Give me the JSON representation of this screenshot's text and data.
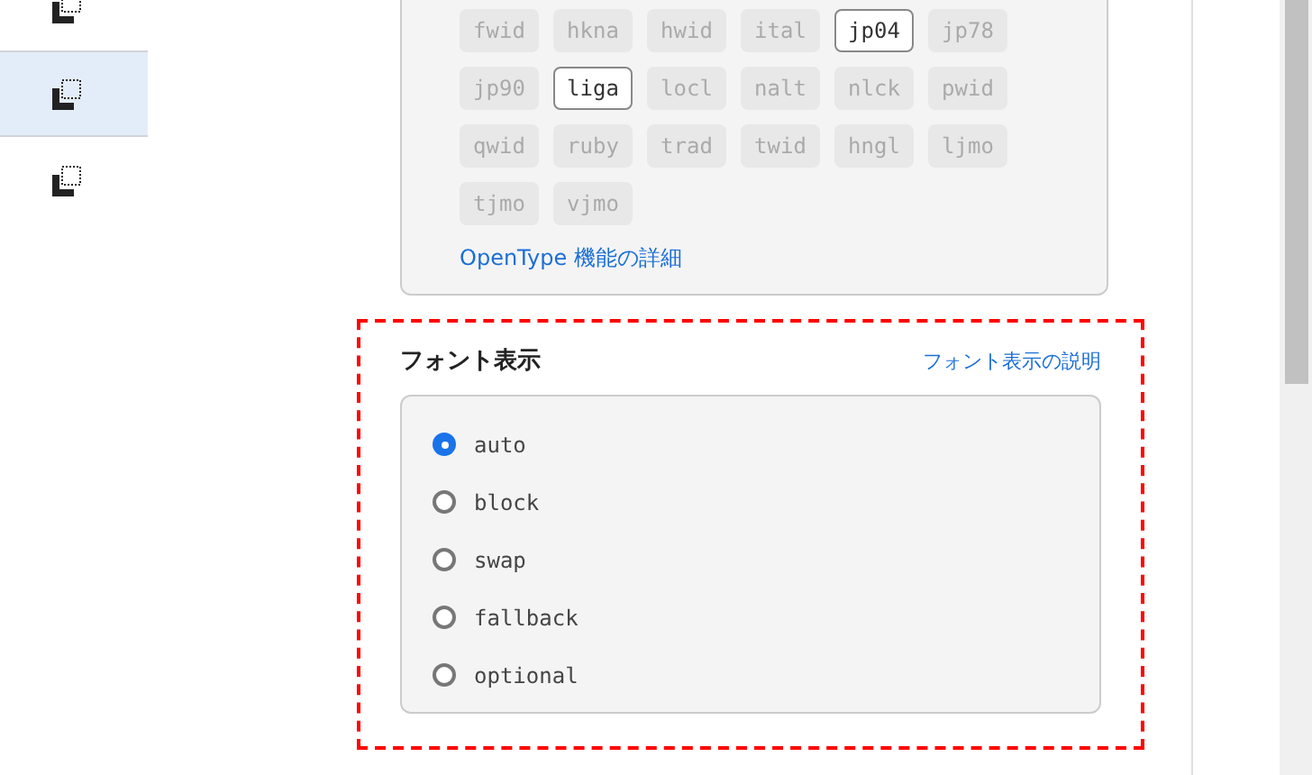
{
  "sidebar": {
    "items": [
      {
        "selected": false
      },
      {
        "selected": true
      },
      {
        "selected": false
      }
    ]
  },
  "opentype": {
    "features": [
      {
        "label": "fwid",
        "enabled": false
      },
      {
        "label": "hkna",
        "enabled": false
      },
      {
        "label": "hwid",
        "enabled": false
      },
      {
        "label": "ital",
        "enabled": false
      },
      {
        "label": "jp04",
        "enabled": true
      },
      {
        "label": "jp78",
        "enabled": false
      },
      {
        "label": "jp90",
        "enabled": false
      },
      {
        "label": "liga",
        "enabled": true
      },
      {
        "label": "locl",
        "enabled": false
      },
      {
        "label": "nalt",
        "enabled": false
      },
      {
        "label": "nlck",
        "enabled": false
      },
      {
        "label": "pwid",
        "enabled": false
      },
      {
        "label": "qwid",
        "enabled": false
      },
      {
        "label": "ruby",
        "enabled": false
      },
      {
        "label": "trad",
        "enabled": false
      },
      {
        "label": "twid",
        "enabled": false
      },
      {
        "label": "hngl",
        "enabled": false
      },
      {
        "label": "ljmo",
        "enabled": false
      },
      {
        "label": "tjmo",
        "enabled": false
      },
      {
        "label": "vjmo",
        "enabled": false
      }
    ],
    "details_link": "OpenType 機能の詳細"
  },
  "font_display": {
    "title": "フォント表示",
    "help_link": "フォント表示の説明",
    "options": [
      {
        "label": "auto",
        "selected": true
      },
      {
        "label": "block",
        "selected": false
      },
      {
        "label": "swap",
        "selected": false
      },
      {
        "label": "fallback",
        "selected": false
      },
      {
        "label": "optional",
        "selected": false
      }
    ]
  }
}
